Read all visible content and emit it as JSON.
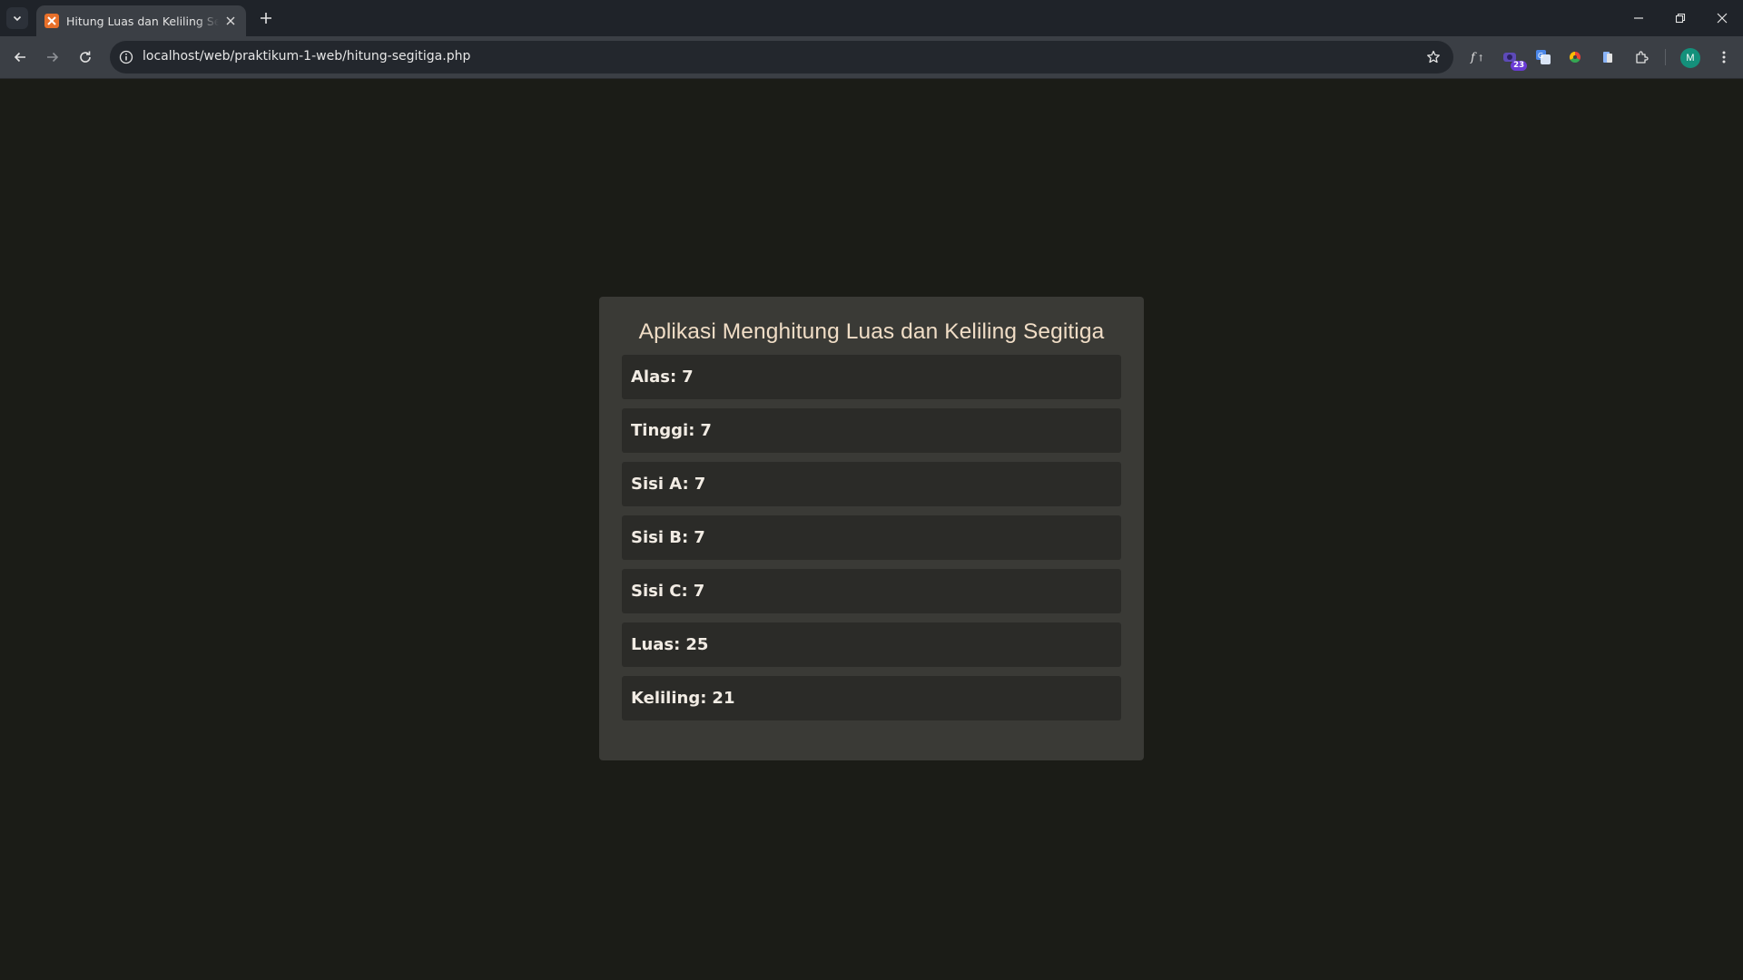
{
  "browser": {
    "tab": {
      "title": "Hitung Luas dan Keliling Segitiga"
    },
    "address": {
      "url": "localhost/web/praktikum-1-web/hitung-segitiga.php"
    },
    "extension_badge": "23",
    "profile_initial": "M"
  },
  "page": {
    "title": "Aplikasi Menghitung Luas dan Keliling Segitiga",
    "rows": [
      {
        "label": "Alas:",
        "value": "7"
      },
      {
        "label": "Tinggi:",
        "value": "7"
      },
      {
        "label": "Sisi A:",
        "value": "7"
      },
      {
        "label": "Sisi B:",
        "value": "7"
      },
      {
        "label": "Sisi C:",
        "value": "7"
      },
      {
        "label": "Luas:",
        "value": "25"
      },
      {
        "label": "Keliling:",
        "value": "21"
      }
    ]
  },
  "colors": {
    "page_background": "#1b1c17",
    "card_background": "#3a3a36",
    "row_background": "#2b2b28",
    "title_color": "#f0ddc6",
    "tab_favicon": "#e8702a",
    "avatar": "#14907b"
  }
}
